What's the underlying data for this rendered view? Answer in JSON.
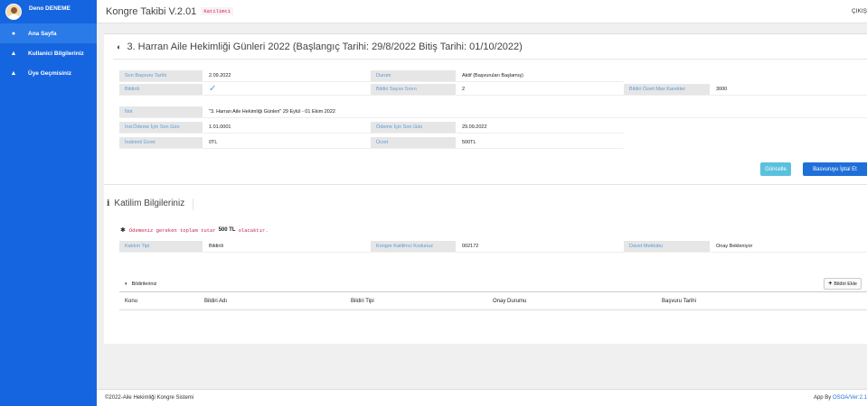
{
  "user": {
    "name": "Deno DENEME"
  },
  "sidebar": {
    "items": [
      {
        "label": "Ana Sayfa",
        "icon": "dashboard-icon"
      },
      {
        "label": "Kullanici Bilgileriniz",
        "icon": "user-icon"
      },
      {
        "label": "Üye Geçmisiniz",
        "icon": "user-history-icon"
      }
    ]
  },
  "header": {
    "title": "Kongre Takibi V.2.01",
    "role_badge": "Katilimci",
    "logout": "ÇIKIŞ"
  },
  "congress": {
    "title": "3. Harran Aile Hekimliği Günleri 2022 (Başlangıç Tarihi: 29/8/2022 Bitiş Tarihi: 01/10/2022)",
    "fields": {
      "son_basvuru_label": "Son Başvuru Tarihi",
      "son_basvuru_value": "2.09.2022",
      "durum_label": "Durum",
      "durum_value": "Aktif (Başvuruları Başlamış)",
      "bildirili_label": "Bildirili",
      "bildiri_sayisi_label": "Bildiri Sayısı Sınırı",
      "bildiri_sayisi_value": "2",
      "ozet_max_label": "Bildiri Özeti Max Karekter",
      "ozet_max_value": "3000",
      "not_label": "Not",
      "not_value": "\"3. Harran Aile Hekimliği Günleri\" 29 Eylül - 01 Ekim 2022",
      "ind_odeme_label": "İnd.Ödeme İçin Son Gün",
      "ind_odeme_value": "1.01.0001",
      "odeme_label": "Ödeme İçin Son Gün",
      "odeme_value": "29.09.2022",
      "indirimli_label": "İndirimli Ücret",
      "indirimli_value": "0TL",
      "ucret_label": "Ücret",
      "ucret_value": "500TL"
    },
    "buttons": {
      "update": "Güncelle",
      "cancel": "Basvuruyu İptal Et"
    }
  },
  "participation": {
    "title": "Katilim Bilgileriniz",
    "notice_prefix": "Ödemeniz gereken toplam tutar",
    "notice_amount": "500 TL",
    "notice_suffix": "olacaktır.",
    "katilim_tipi_label": "Katılım Tipi",
    "katilim_tipi_value": "Bildirili",
    "kod_label": "Kongre Katilimci Kodunuz",
    "kod_value": "002172",
    "davet_label": "Davet Mektubu",
    "davet_value": "Onay Bekleniyor"
  },
  "papers": {
    "title": "Bildirileriniz",
    "add_button": "Bildiri Ekle",
    "columns": [
      "Konu",
      "Bildiri Adı",
      "Bildiri Tipi",
      "Onay Durumu",
      "Başvuru Tarihi"
    ]
  },
  "footer": {
    "left": "©2022-Aile Hekimliği Kongre Sistemi",
    "right_prefix": "App By",
    "right_link": "OSOA/Ver:2.1"
  },
  "colors": {
    "sidebar": "#1565e0",
    "label_text": "#5b9bd5",
    "primary_button": "#1f6fd9",
    "info_button": "#5bc0de"
  }
}
